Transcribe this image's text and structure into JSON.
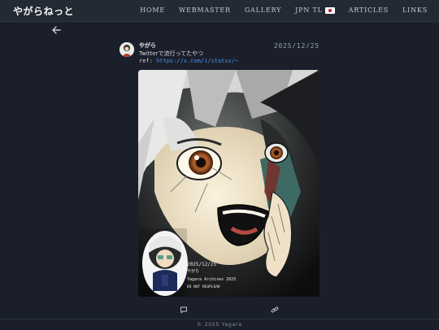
{
  "site": {
    "brand": "やがらねっと"
  },
  "nav": {
    "items": [
      {
        "label": "HOME"
      },
      {
        "label": "WEBMASTER"
      },
      {
        "label": "GALLERY"
      },
      {
        "label": "JPN TL"
      },
      {
        "label": "ARTICLES"
      },
      {
        "label": "LINKS"
      }
    ],
    "flag_icon": "japan-flag-icon"
  },
  "post": {
    "author": "やがら",
    "date": "2025/12/25",
    "text": "Twitterで流行ってたやつ",
    "ref_prefix": "ref: ",
    "ref_link": "https://x.com/i/status/~",
    "image_caption_lines": [
      "2025/12/25",
      "やがら",
      "Yagara Archives 2025",
      "DO NOT REUPLOAD"
    ]
  },
  "actions": {
    "comment_icon": "comment-icon",
    "link_icon": "link-icon"
  },
  "footer": {
    "text": "© 2025 Yagara"
  },
  "colors": {
    "bg": "#1a1f2b",
    "topbar": "#232a33",
    "link": "#4a90e2",
    "flag_red": "#c8102e"
  }
}
